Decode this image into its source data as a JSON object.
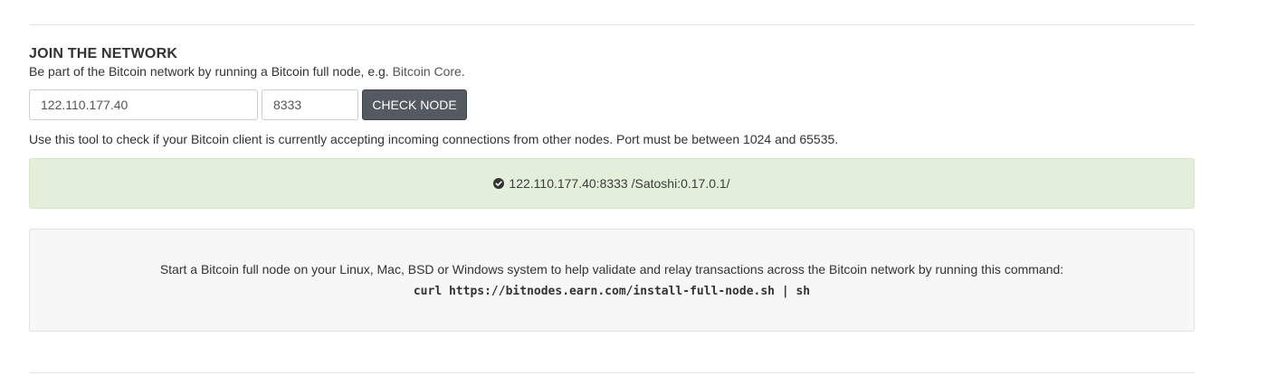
{
  "section": {
    "title": "JOIN THE NETWORK",
    "intro_prefix": "Be part of the Bitcoin network by running a Bitcoin full node, e.g. ",
    "intro_link": "Bitcoin Core",
    "intro_suffix": "."
  },
  "form": {
    "host_value": "122.110.177.40",
    "port_value": "8333",
    "check_button_label": "CHECK NODE"
  },
  "help_text": "Use this tool to check if your Bitcoin client is currently accepting incoming connections from other nodes. Port must be between 1024 and 65535.",
  "result": {
    "icon": "check-circle-icon",
    "text": "122.110.177.40:8333 /Satoshi:0.17.0.1/",
    "background_color": "#e3efda",
    "border_color": "#d6e9c6"
  },
  "install": {
    "description": "Start a Bitcoin full node on your Linux, Mac, BSD or Windows system to help validate and relay transactions across the Bitcoin network by running this command:",
    "command": "curl https://bitnodes.earn.com/install-full-node.sh | sh"
  },
  "colors": {
    "button_bg": "#545a60",
    "button_text": "#ffffff"
  }
}
